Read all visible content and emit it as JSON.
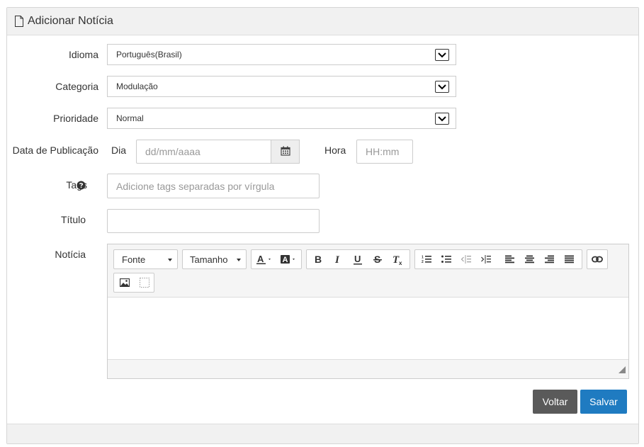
{
  "panel": {
    "title": "Adicionar Notícia"
  },
  "form": {
    "idioma": {
      "label": "Idioma",
      "value": "Português(Brasil)"
    },
    "categoria": {
      "label": "Categoria",
      "value": "Modulação"
    },
    "prioridade": {
      "label": "Prioridade",
      "value": "Normal"
    },
    "data_publicacao": {
      "label": "Data de Publicação",
      "dia_label": "Dia",
      "dia_placeholder": "dd/mm/aaaa",
      "hora_label": "Hora",
      "hora_placeholder": "HH:mm"
    },
    "tags": {
      "label": "Tags",
      "placeholder": "Adicione tags separadas por vírgula"
    },
    "titulo": {
      "label": "Título",
      "value": ""
    },
    "noticia": {
      "label": "Notícia"
    }
  },
  "editor": {
    "font_label": "Fonte",
    "size_label": "Tamanho",
    "icons": [
      "text-color-icon",
      "highlight-color-icon",
      "bold-icon",
      "italic-icon",
      "underline-icon",
      "strikethrough-icon",
      "clear-format-icon",
      "ordered-list-icon",
      "unordered-list-icon",
      "outdent-icon",
      "indent-icon",
      "align-left-icon",
      "align-center-icon",
      "align-right-icon",
      "justify-icon",
      "link-icon",
      "image-icon",
      "video-icon"
    ]
  },
  "actions": {
    "back_label": "Voltar",
    "save_label": "Salvar"
  },
  "colors": {
    "primary": "#1f7bc1",
    "back": "#5a5a5a",
    "panel_heading": "#f1f1f1"
  }
}
